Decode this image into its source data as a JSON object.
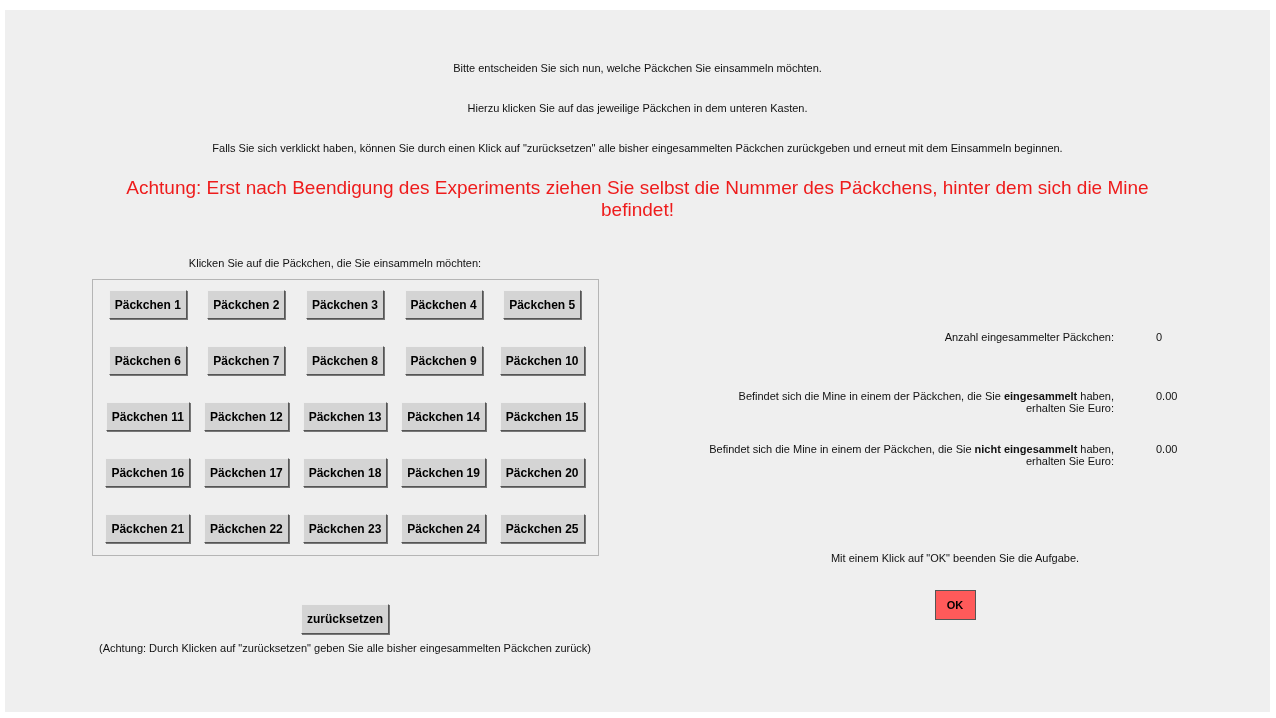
{
  "instructions": [
    "Bitte entscheiden Sie sich nun, welche Päckchen Sie einsammeln möchten.",
    "Hierzu klicken Sie auf das jeweilige Päckchen in dem unteren Kasten.",
    "Falls Sie sich verklickt haben, können Sie durch einen Klick auf \"zurücksetzen\" alle bisher eingesammelten Päckchen zurückgeben und erneut mit dem Einsammeln beginnen."
  ],
  "warning": "Achtung: Erst nach Beendigung des Experiments ziehen Sie selbst die Nummer des Päckchens, hinter dem sich die Mine befindet!",
  "packages_prompt": "Klicken Sie auf die Päckchen, die Sie einsammeln möchten:",
  "packages": [
    "Päckchen 1",
    "Päckchen 2",
    "Päckchen 3",
    "Päckchen 4",
    "Päckchen 5",
    "Päckchen 6",
    "Päckchen 7",
    "Päckchen 8",
    "Päckchen 9",
    "Päckchen 10",
    "Päckchen 11",
    "Päckchen 12",
    "Päckchen 13",
    "Päckchen 14",
    "Päckchen 15",
    "Päckchen 16",
    "Päckchen 17",
    "Päckchen 18",
    "Päckchen 19",
    "Päckchen 20",
    "Päckchen 21",
    "Päckchen 22",
    "Päckchen 23",
    "Päckchen 24",
    "Päckchen 25"
  ],
  "reset_button": "zurücksetzen",
  "reset_note": "(Achtung: Durch Klicken auf \"zurücksetzen\" geben Sie alle bisher eingesammelten Päckchen zurück)",
  "summary": [
    {
      "label": "Anzahl eingesammelter Päckchen:",
      "value": "0"
    },
    {
      "label": "Befindet sich die Mine in einem der Päckchen, die Sie **eingesammelt** haben, erhalten Sie Euro:",
      "value": "0.00"
    },
    {
      "label": "Befindet sich die Mine in einem der Päckchen, die Sie **nicht eingesammelt** haben, erhalten Sie Euro:",
      "value": "0.00"
    }
  ],
  "ok_hint": "Mit einem Klick auf \"OK\" beenden Sie die Aufgabe.",
  "ok_button": "OK"
}
